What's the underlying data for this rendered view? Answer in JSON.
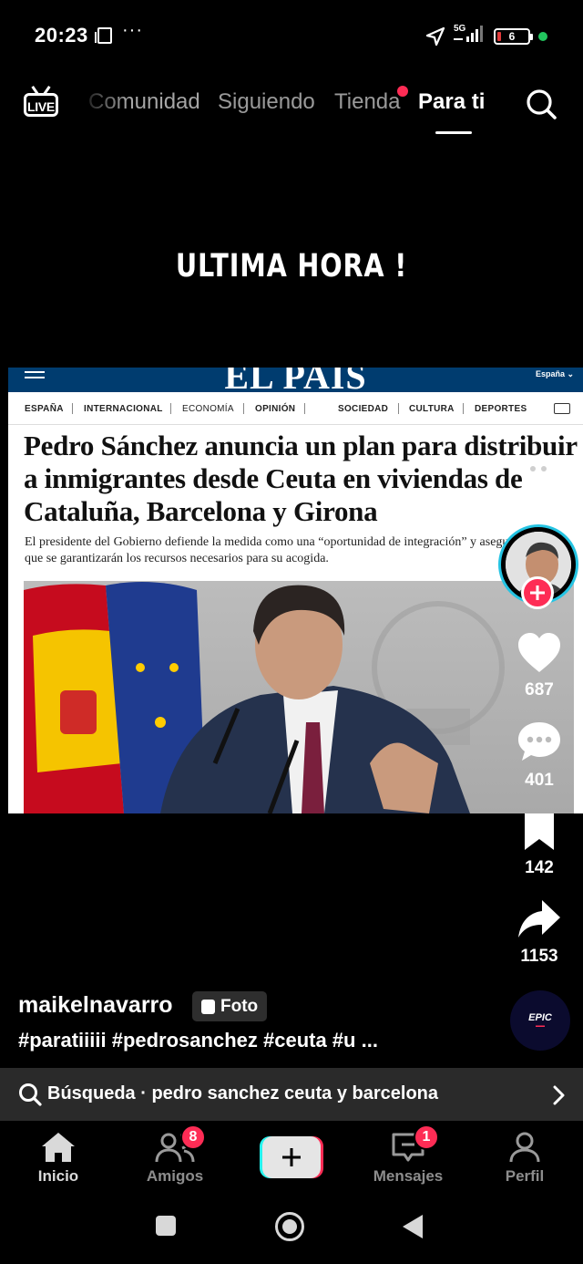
{
  "status_bar": {
    "time": "20:23",
    "network": "5G",
    "battery": "6",
    "battery_color": "#e23a3a"
  },
  "top_nav": {
    "live_label": "LIVE",
    "tabs": [
      {
        "label": "Comunidad"
      },
      {
        "label": "Siguiendo"
      },
      {
        "label": "Tienda",
        "has_dot": true
      },
      {
        "label": "Para ti",
        "active": true
      }
    ]
  },
  "video": {
    "headline": "ULTIMA HORA !",
    "newspaper": {
      "logo": "EL PAÍS",
      "region": "España ⌄",
      "sections": [
        "ESPAÑA",
        "INTERNACIONAL",
        "ECONOMÍA",
        "OPINIÓN",
        "SOCIEDAD",
        "CULTURA",
        "DEPORTES"
      ],
      "title": "Pedro Sánchez anuncia un plan para distribuir a inmigrantes desde Ceuta en viviendas de Cataluña, Barcelona y Girona",
      "subtitle": "El presidente del Gobierno defiende la medida como una “oportunidad de integración” y asegura que se garantizarán los recursos necesarios para su acogida."
    }
  },
  "actions": {
    "likes": "687",
    "comments": "401",
    "saves": "142",
    "shares": "1153",
    "music_label": "EPIC"
  },
  "post": {
    "author": "maikelnavarro",
    "type_badge": "Foto",
    "caption": "#paratiiiii #pedrosanchez #ceuta #u ..."
  },
  "search_suggestion": {
    "text": "Búsqueda · pedro sanchez ceuta y barcelona"
  },
  "bottom_nav": {
    "items": [
      {
        "label": "Inicio",
        "active": true
      },
      {
        "label": "Amigos",
        "badge": "8"
      },
      {
        "label": "Mensajes",
        "badge": "1"
      },
      {
        "label": "Perfil"
      }
    ]
  },
  "colors": {
    "accent": "#fe2c55",
    "cyan": "#25f4ee",
    "paper_masthead": "#003c6f"
  }
}
